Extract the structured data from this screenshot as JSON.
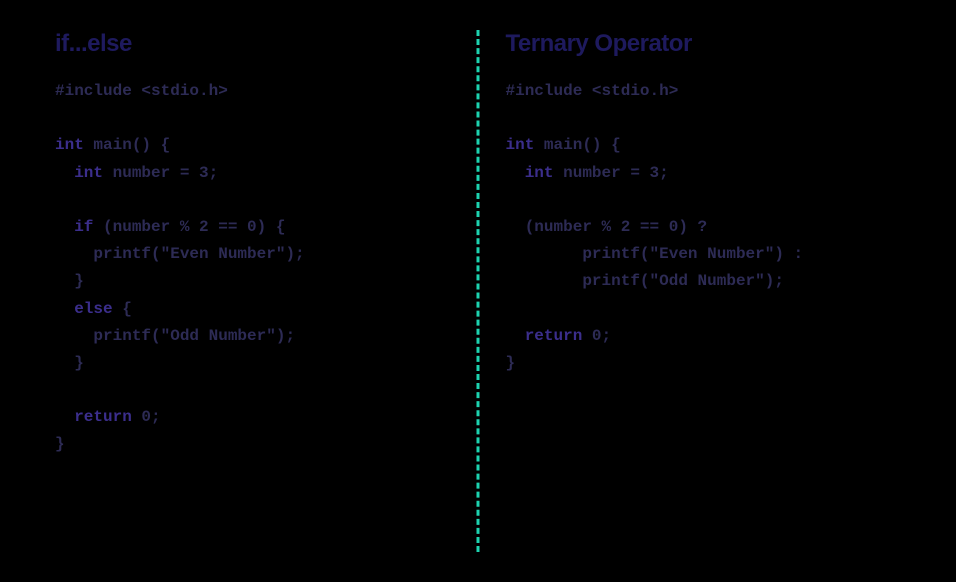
{
  "left": {
    "heading": "if...else",
    "lines": [
      {
        "pre": "",
        "kw": "",
        "post": "#include <stdio.h>"
      },
      {
        "pre": "",
        "kw": "",
        "post": ""
      },
      {
        "pre": "",
        "kw": "int",
        "post": " main() {"
      },
      {
        "pre": "  ",
        "kw": "int",
        "post": " number = 3;"
      },
      {
        "pre": "",
        "kw": "",
        "post": ""
      },
      {
        "pre": "  ",
        "kw": "if",
        "post": " (number % 2 == 0) {"
      },
      {
        "pre": "    ",
        "kw": "",
        "post": "printf(\"Even Number\");"
      },
      {
        "pre": "  ",
        "kw": "",
        "post": "}"
      },
      {
        "pre": "  ",
        "kw": "else",
        "post": " {"
      },
      {
        "pre": "    ",
        "kw": "",
        "post": "printf(\"Odd Number\");"
      },
      {
        "pre": "  ",
        "kw": "",
        "post": "}"
      },
      {
        "pre": "",
        "kw": "",
        "post": ""
      },
      {
        "pre": "  ",
        "kw": "return",
        "post": " 0;"
      },
      {
        "pre": "",
        "kw": "",
        "post": "}"
      }
    ]
  },
  "right": {
    "heading": "Ternary Operator",
    "lines": [
      {
        "pre": "",
        "kw": "",
        "post": "#include <stdio.h>"
      },
      {
        "pre": "",
        "kw": "",
        "post": ""
      },
      {
        "pre": "",
        "kw": "int",
        "post": " main() {"
      },
      {
        "pre": "  ",
        "kw": "int",
        "post": " number = 3;"
      },
      {
        "pre": "",
        "kw": "",
        "post": ""
      },
      {
        "pre": "  ",
        "kw": "",
        "post": "(number % 2 == 0) ?"
      },
      {
        "pre": "        ",
        "kw": "",
        "post": "printf(\"Even Number\") :"
      },
      {
        "pre": "        ",
        "kw": "",
        "post": "printf(\"Odd Number\");"
      },
      {
        "pre": "",
        "kw": "",
        "post": ""
      },
      {
        "pre": "  ",
        "kw": "return",
        "post": " 0;"
      },
      {
        "pre": "",
        "kw": "",
        "post": "}"
      }
    ]
  }
}
